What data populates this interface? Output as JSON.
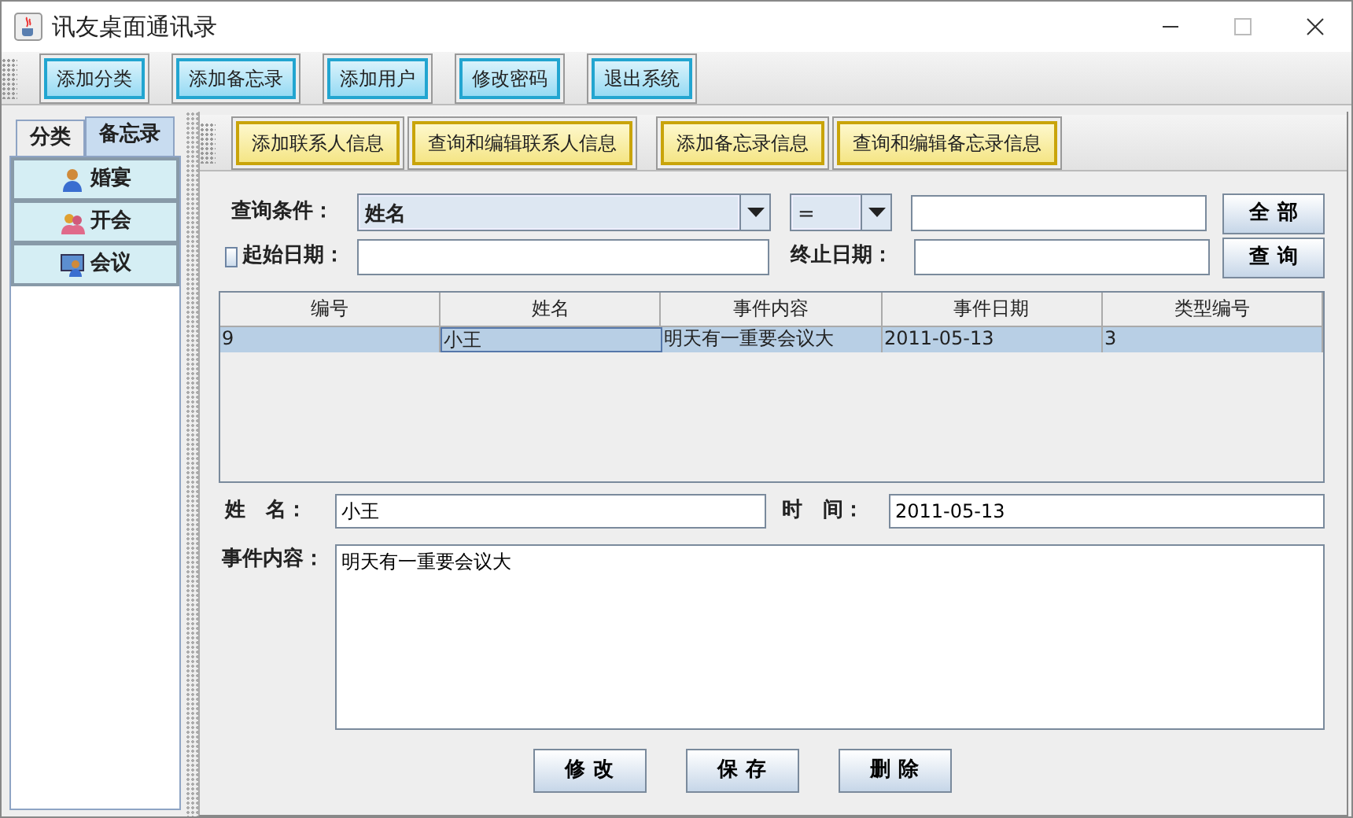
{
  "window": {
    "title": "讯友桌面通讯录"
  },
  "toolbar": [
    "添加分类",
    "添加备忘录",
    "添加用户",
    "修改密码",
    "退出系统"
  ],
  "side_tabs": [
    {
      "label": "分类",
      "selected": false
    },
    {
      "label": "备忘录",
      "selected": true
    }
  ],
  "categories": [
    {
      "label": "婚宴"
    },
    {
      "label": "开会"
    },
    {
      "label": "会议"
    }
  ],
  "sub_toolbar": [
    "添加联系人信息",
    "查询和编辑联系人信息",
    "添加备忘录信息",
    "查询和编辑备忘录信息"
  ],
  "query": {
    "condition_label": "查询条件：",
    "field_value": "姓名",
    "operator_value": "=",
    "all_button": "全 部",
    "start_date": {
      "label": "起始日期：",
      "checked": false
    },
    "end_label": "终止日期：",
    "search_button": "查 询"
  },
  "table": {
    "columns": [
      "编号",
      "姓名",
      "事件内容",
      "事件日期",
      "类型编号"
    ],
    "rows": [
      {
        "cells": [
          "9",
          "小王",
          "明天有一重要会议大",
          "2011-05-13",
          "3"
        ],
        "selected": true
      }
    ]
  },
  "detail": {
    "name_label": "姓　名：",
    "name_value": "小王",
    "time_label": "时　间：",
    "time_value": "2011-05-13",
    "content_label": "事件内容：",
    "content_value": "明天有一重要会议大"
  },
  "actions": [
    "修 改",
    "保 存",
    "删 除"
  ]
}
